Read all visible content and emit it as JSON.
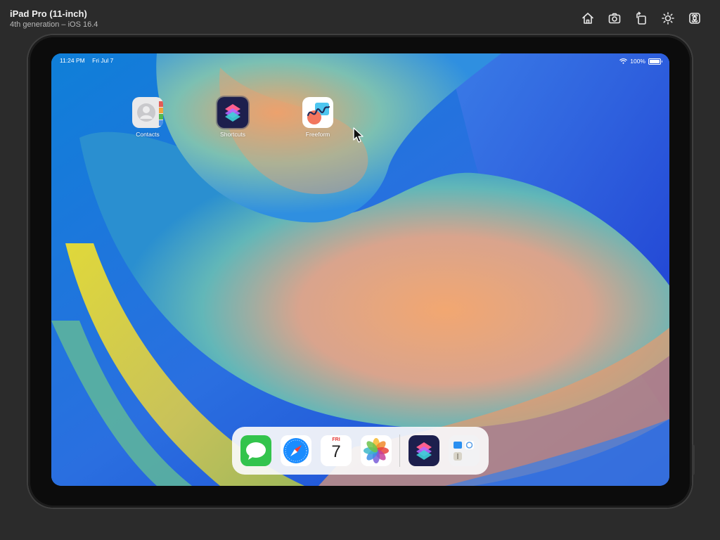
{
  "simulator": {
    "device_name": "iPad Pro (11-inch)",
    "device_info": "4th generation – iOS 16.4",
    "toolbar": [
      "home-icon",
      "screenshot-icon",
      "rotate-icon",
      "appearance-icon",
      "command-icon"
    ]
  },
  "status_bar": {
    "time": "11:24 PM",
    "date": "Fri Jul 7",
    "battery_text": "100%",
    "battery_level": 1.0
  },
  "home_apps": [
    {
      "label": "Contacts"
    },
    {
      "label": "Shortcuts"
    },
    {
      "label": "Freeform"
    }
  ],
  "dock": {
    "apps": [
      "messages-icon",
      "safari-icon",
      "calendar-icon",
      "photos-icon",
      "shortcuts-icon",
      "app-library-icon"
    ],
    "calendar_day": "FRI",
    "calendar_date": "7"
  },
  "colors": {
    "shortcuts_bg": "#1d1f4d",
    "messages_green": "#33c44c",
    "safari_blue": "#1a8cff"
  }
}
